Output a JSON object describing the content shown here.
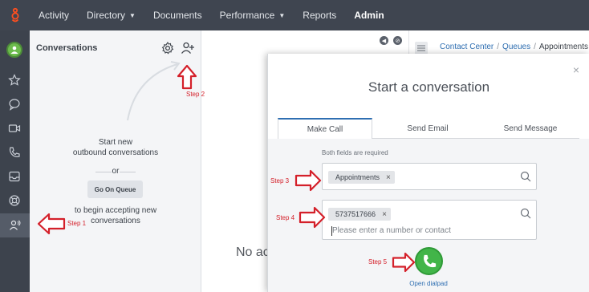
{
  "topnav": {
    "items": [
      {
        "label": "Activity",
        "has_caret": false
      },
      {
        "label": "Directory",
        "has_caret": true
      },
      {
        "label": "Documents",
        "has_caret": false
      },
      {
        "label": "Performance",
        "has_caret": true
      },
      {
        "label": "Reports",
        "has_caret": false
      },
      {
        "label": "Admin",
        "has_caret": false,
        "active": true
      }
    ],
    "logo_icon": "genesys-logo-icon",
    "caret_glyph": "▼",
    "brand_color": "#ff4f1f"
  },
  "rail": {
    "icons": [
      "star-icon",
      "chat-icon",
      "video-icon",
      "phone-icon",
      "inbox-icon",
      "lifebuoy-icon",
      "conversations-people-icon"
    ],
    "selected": "conversations-people-icon"
  },
  "conversations": {
    "title": "Conversations",
    "line1": "Start new",
    "line2": "outbound conversations",
    "or": "or",
    "go_on_queue": "Go On Queue",
    "line3": "to begin accepting new",
    "line4": "conversations"
  },
  "main": {
    "breadcrumb": [
      "Contact Center",
      "Queues",
      "Appointments"
    ],
    "sep": "/",
    "no_active_text": "No ac"
  },
  "modal": {
    "close_glyph": "×",
    "title": "Start a conversation",
    "tabs": [
      "Make Call",
      "Send Email",
      "Send Message"
    ],
    "active_tab": "Make Call",
    "required_note": "Both fields are required",
    "queue_chip": "Appointments",
    "number_chip": "5737517666",
    "chip_remove": "×",
    "number_placeholder": "Please enter a number or contact",
    "open_dialpad": "Open dialpad"
  },
  "steps": {
    "step1": "Step 1",
    "step2": "Step 2",
    "step3": "Step 3",
    "step4": "Step 4",
    "step5": "Step 5"
  },
  "colors": {
    "nav_bg": "#3f4550",
    "accent_blue": "#2f6fb2",
    "call_green": "#42b549",
    "annotation_red": "#d4202a"
  }
}
